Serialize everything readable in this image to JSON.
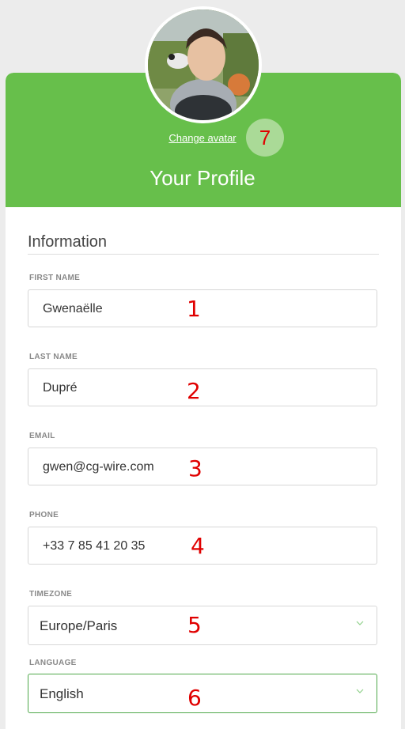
{
  "profile": {
    "title": "Your Profile",
    "change_avatar_label": "Change avatar",
    "section_title": "Information"
  },
  "fields": {
    "first_name": {
      "label": "FIRST NAME",
      "value": "Gwenaëlle"
    },
    "last_name": {
      "label": "LAST NAME",
      "value": "Dupré"
    },
    "email": {
      "label": "EMAIL",
      "value": "gwen@cg-wire.com"
    },
    "phone": {
      "label": "PHONE",
      "value": "+33 7 85 41 20 35"
    },
    "timezone": {
      "label": "TIMEZONE",
      "value": "Europe/Paris"
    },
    "language": {
      "label": "LANGUAGE",
      "value": "English"
    }
  },
  "annotations": [
    "1",
    "2",
    "3",
    "4",
    "5",
    "6",
    "7"
  ],
  "colors": {
    "header_green": "#67bf4b",
    "annotation_red": "#e00000",
    "active_border": "#4fa84a",
    "chevron": "#8fd08a"
  },
  "icons": {
    "dropdown": "chevron-down-icon",
    "avatar": "avatar-photo"
  }
}
